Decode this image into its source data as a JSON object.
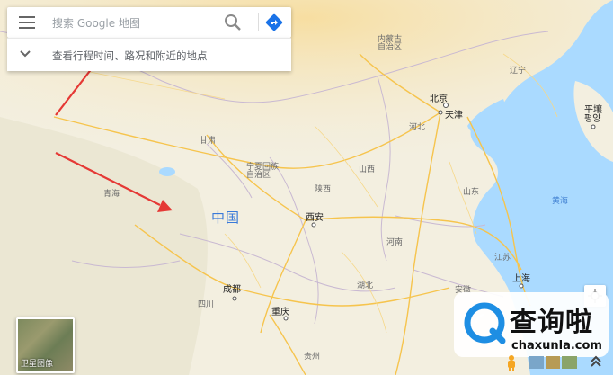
{
  "search": {
    "placeholder": "搜索 Google 地图",
    "directions_hint": "查看行程时间、路况和附近的地点"
  },
  "map": {
    "country_label": "中国",
    "places": [
      {
        "name": "内蒙古自治区",
        "text": "内蒙古\n自治区",
        "kind": "province"
      },
      {
        "name": "北京",
        "text": "北京",
        "kind": "city"
      },
      {
        "name": "天津",
        "text": "天津",
        "kind": "city"
      },
      {
        "name": "河北",
        "text": "河北",
        "kind": "province"
      },
      {
        "name": "辽宁",
        "text": "辽宁",
        "kind": "province"
      },
      {
        "name": "平壤",
        "text": "平壤\n평양",
        "kind": "city"
      },
      {
        "name": "甘肃",
        "text": "甘肃",
        "kind": "province"
      },
      {
        "name": "宁夏回族自治区",
        "text": "宁夏回族\n自治区",
        "kind": "province"
      },
      {
        "name": "山西",
        "text": "山西",
        "kind": "province"
      },
      {
        "name": "山东",
        "text": "山东",
        "kind": "province"
      },
      {
        "name": "黄海",
        "text": "黄海",
        "kind": "sea"
      },
      {
        "name": "青海",
        "text": "青海",
        "kind": "province"
      },
      {
        "name": "陕西",
        "text": "陕西",
        "kind": "province"
      },
      {
        "name": "西安",
        "text": "西安",
        "kind": "city"
      },
      {
        "name": "河南",
        "text": "河南",
        "kind": "province"
      },
      {
        "name": "江苏",
        "text": "江苏",
        "kind": "province"
      },
      {
        "name": "安徽",
        "text": "安徽",
        "kind": "province"
      },
      {
        "name": "上海",
        "text": "上海",
        "kind": "city"
      },
      {
        "name": "湖北",
        "text": "湖北",
        "kind": "province"
      },
      {
        "name": "成都",
        "text": "成都",
        "kind": "city"
      },
      {
        "name": "四川",
        "text": "四川",
        "kind": "province"
      },
      {
        "name": "重庆",
        "text": "重庆",
        "kind": "city"
      },
      {
        "name": "贵州",
        "text": "贵州",
        "kind": "province"
      }
    ]
  },
  "controls": {
    "satellite_label": "卫星图像"
  },
  "watermark": {
    "title": "查询啦",
    "domain": "chaxunla.com"
  },
  "colors": {
    "land": "#f4ecd3",
    "land_north": "#f7e6b8",
    "water": "#aadaff",
    "road_major": "#f6c44d",
    "arrow": "#e53935",
    "accent_blue": "#1a73e8",
    "watermark_blue": "#1e8ee3"
  }
}
